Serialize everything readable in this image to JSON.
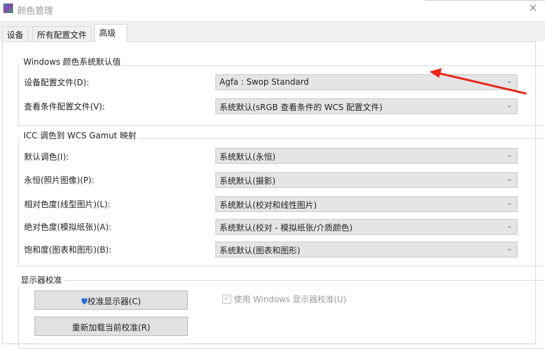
{
  "window": {
    "title": "颜色管理",
    "close": "✕"
  },
  "tabs": [
    {
      "label": "设备"
    },
    {
      "label": "所有配置文件"
    },
    {
      "label": "高级",
      "selected": true
    }
  ],
  "group1": {
    "legend": "Windows 颜色系统默认值",
    "rows": [
      {
        "label": "设备配置文件(D):",
        "value": "Agfa : Swop Standard"
      },
      {
        "label": "查看条件配置文件(V):",
        "value": "系统默认(sRGB 查看条件的 WCS 配置文件)"
      }
    ]
  },
  "group2": {
    "legend": "ICC 调色到 WCS Gamut 映射",
    "rows": [
      {
        "label": "默认调色(I):",
        "value": "系统默认(永恒)"
      },
      {
        "label": "永恒(照片图像)(P):",
        "value": "系统默认(摄影)"
      },
      {
        "label": "相对色度(线型图片)(L):",
        "value": "系统默认(校对和线性图片)"
      },
      {
        "label": "绝对色度(模拟纸张)(A):",
        "value": "系统默认(校对 - 模拟纸张/介质颜色)"
      },
      {
        "label": "饱和度(图表和图形)(B):",
        "value": "系统默认(图表和图形)"
      }
    ]
  },
  "group3": {
    "legend": "显示器校准",
    "calibrate": "校准显示器(C)",
    "reload": "重新加载当前校准(R)",
    "use_windows": "使用 Windows 显示器校准(U)",
    "use_windows_checked": true
  },
  "colors": {
    "arrow": "#e8261c"
  }
}
